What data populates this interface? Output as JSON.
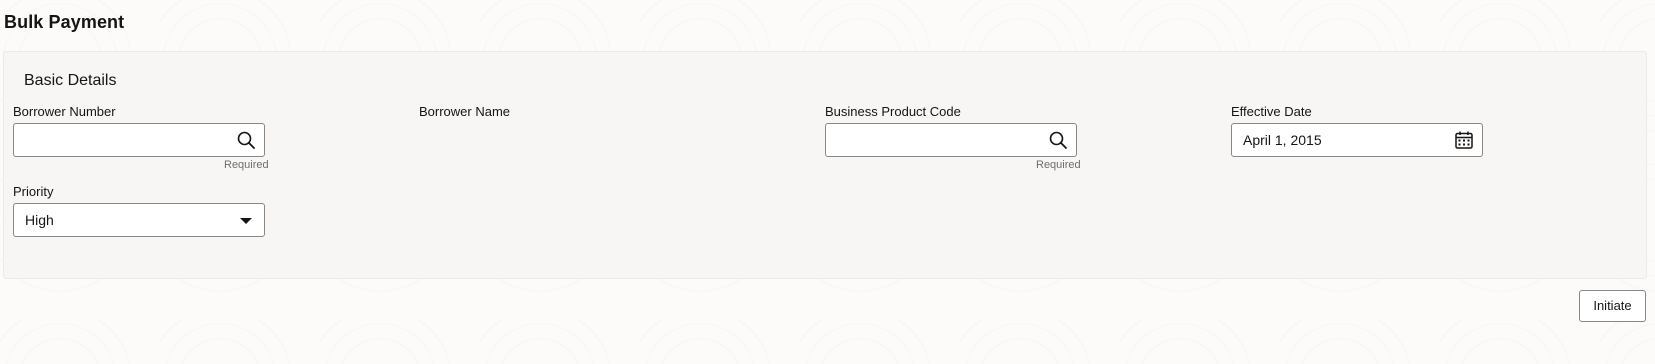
{
  "page": {
    "title": "Bulk Payment"
  },
  "section": {
    "title": "Basic Details"
  },
  "fields": {
    "borrower_number": {
      "label": "Borrower Number",
      "value": "",
      "helper": "Required",
      "icon": "search-icon"
    },
    "borrower_name": {
      "label": "Borrower Name"
    },
    "business_product_code": {
      "label": "Business Product Code",
      "value": "",
      "helper": "Required",
      "icon": "search-icon"
    },
    "effective_date": {
      "label": "Effective Date",
      "value": "April 1, 2015",
      "icon": "calendar-icon"
    },
    "priority": {
      "label": "Priority",
      "value": "High",
      "icon": "caret-down-icon"
    }
  },
  "actions": {
    "initiate_label": "Initiate"
  }
}
